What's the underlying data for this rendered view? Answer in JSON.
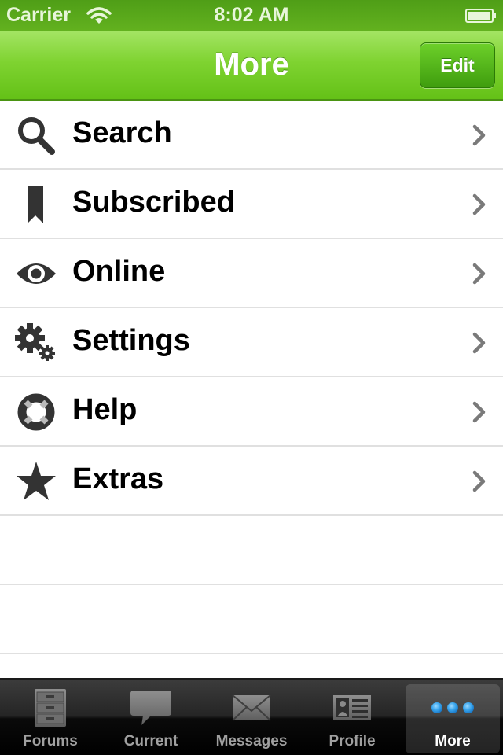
{
  "status_bar": {
    "carrier": "Carrier",
    "time": "8:02 AM",
    "wifi_icon": "wifi-icon",
    "battery_icon": "battery-full-icon"
  },
  "nav_bar": {
    "title": "More",
    "edit_label": "Edit"
  },
  "menu": {
    "items": [
      {
        "label": "Search",
        "icon": "search-icon"
      },
      {
        "label": "Subscribed",
        "icon": "bookmark-icon"
      },
      {
        "label": "Online",
        "icon": "eye-icon"
      },
      {
        "label": "Settings",
        "icon": "gears-icon"
      },
      {
        "label": "Help",
        "icon": "lifebuoy-icon"
      },
      {
        "label": "Extras",
        "icon": "star-icon"
      }
    ]
  },
  "tab_bar": {
    "tabs": [
      {
        "label": "Forums",
        "icon": "file-cabinet-icon",
        "active": false
      },
      {
        "label": "Current",
        "icon": "speech-bubble-icon",
        "active": false
      },
      {
        "label": "Messages",
        "icon": "envelope-icon",
        "active": false
      },
      {
        "label": "Profile",
        "icon": "profile-card-icon",
        "active": false
      },
      {
        "label": "More",
        "icon": "more-dots-icon",
        "active": true
      }
    ]
  },
  "colors": {
    "nav_green": "#7fd331",
    "status_green": "#5aa81b",
    "accent_blue": "#3aa6ee"
  }
}
